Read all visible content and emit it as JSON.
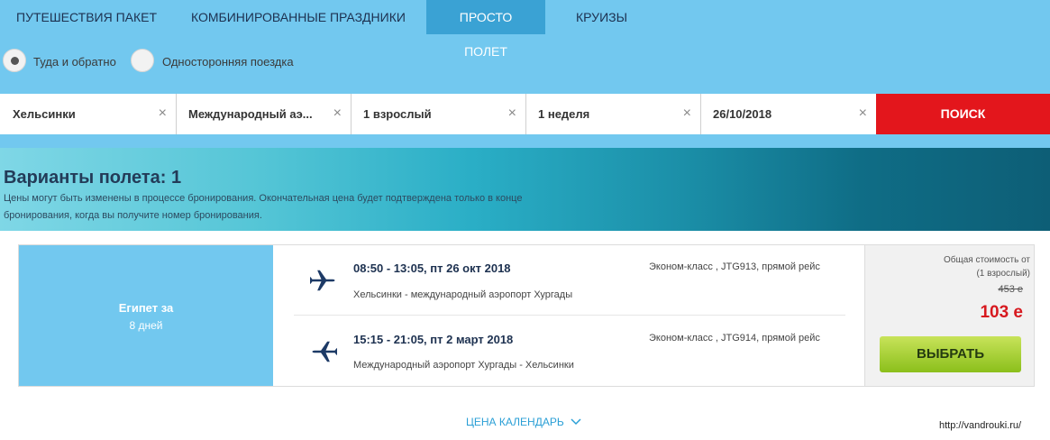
{
  "tabs": [
    {
      "label": "ПУТЕШЕСТВИЯ ПАКЕТ"
    },
    {
      "label": "КОМБИНИРОВАННЫЕ ПРАЗДНИКИ"
    },
    {
      "label": "ПРОСТО ПОЛЕТ",
      "active": true
    },
    {
      "label": "КРУИЗЫ"
    }
  ],
  "trip_type": {
    "round_trip": {
      "label": "Туда и обратно",
      "selected": true
    },
    "one_way": {
      "label": "Односторонняя поездка",
      "selected": false
    }
  },
  "search": {
    "origin": "Хельсинки",
    "destination": "Международный аэ...",
    "passengers": "1 взрослый",
    "duration": "1 неделя",
    "date": "26/10/2018",
    "clear_glyph": "×",
    "button_label": "ПОИСК"
  },
  "banner": {
    "title": "Варианты полета: 1",
    "note": "Цены могут быть изменены в процессе бронирования. Окончательная цена будет подтверждена только в конце бронирования, когда вы получите номер бронирования."
  },
  "result": {
    "destination": "Египет за",
    "duration": "8 дней",
    "outbound": {
      "time": "08:50 - 13:05, пт 26 окт 2018",
      "route": "Хельсинки - международный аэропорт Хургады",
      "details": "Эконом-класс , JTG913, прямой рейс",
      "icon": "plane-right-icon"
    },
    "inbound": {
      "time": "15:15 - 21:05, пт 2 март 2018",
      "route": "Международный аэропорт Хургады - Хельсинки",
      "details": "Эконом-класс , JTG914, прямой рейс",
      "icon": "plane-left-icon"
    },
    "price": {
      "label": "Общая стоимость от",
      "pax": "(1 взрослый)",
      "old": "453 е",
      "new": "103 е",
      "button_label": "ВЫБРАТЬ"
    }
  },
  "calendar_link": "ЦЕНА КАЛЕНДАРЬ",
  "watermark": "http://vandrouki.ru/",
  "colors": {
    "page_bg": "#72c8ef",
    "active_tab": "#3aa2d4",
    "search_button": "#e3161c",
    "price_red": "#d7191f",
    "select_green": "#8bbf1b"
  }
}
